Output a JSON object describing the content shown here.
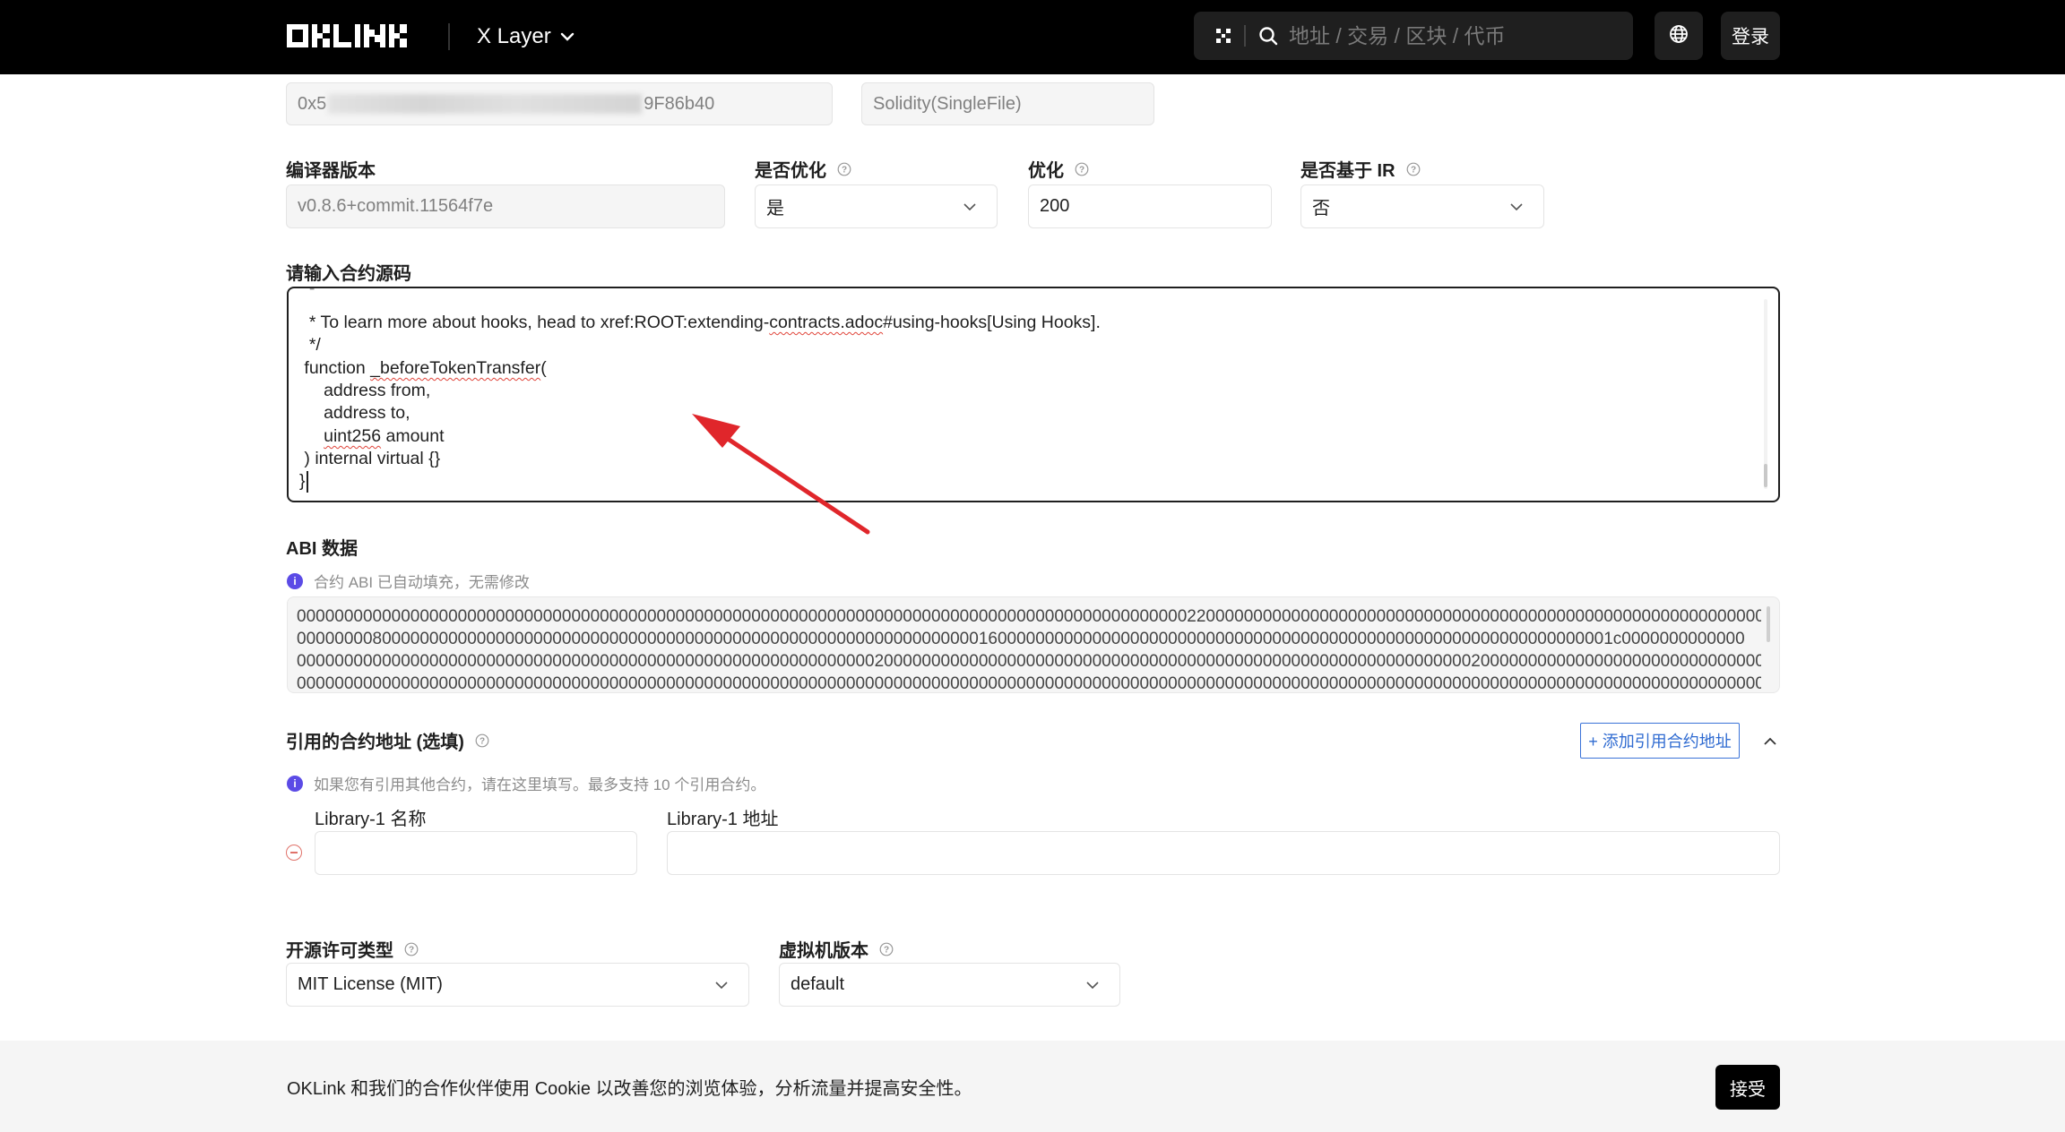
{
  "header": {
    "logo": "OKLINK",
    "network": "X Layer",
    "search_placeholder": "地址 / 交易 / 区块 / 代币",
    "login": "登录"
  },
  "top_fields": {
    "address_prefix": "0x5",
    "address_suffix": "9F86b40",
    "compiler_type": "Solidity(SingleFile)"
  },
  "compiler": {
    "version_label": "编译器版本",
    "version_value": "v0.8.6+commit.11564f7e",
    "optimize_label": "是否优化",
    "optimize_value": "是",
    "runs_label": "优化",
    "runs_value": "200",
    "ir_label": "是否基于 IR",
    "ir_value": "否"
  },
  "source": {
    "label": "请输入合约源码",
    "lines": [
      "  * To learn more about hooks, head to xref:ROOT:extending-contracts.adoc#using-hooks[Using Hooks].",
      "  */",
      " function _beforeTokenTransfer(",
      "     address from,",
      "     address to,",
      "     uint256 amount",
      " ) internal virtual {}",
      "}"
    ]
  },
  "abi": {
    "label": "ABI 数据",
    "note": "合约 ABI 已自动填充，无需修改",
    "lines": [
      "0000000000000000000000000000000000000000000000000000000000000000000000000000000000000000000000220000000000000000000000000000000000000000000000000000000000000000",
      "0000000080000000000000000000000000000000000000000000000000000000000000001600000000000000000000000000000000000000000000000000000000000000001c0000000000000",
      "0000000000000000000000000000000000000000000000000000000000000200000000000000000000000000000000000000000000000000000000000000200000000000000000000000000000000000",
      "0000000000000000000000000000000000000000000000000000000000000000000000000000000000000000000000000000000000000000000000000000000000000000000000000000000000000000"
    ]
  },
  "libraries": {
    "label": "引用的合约地址 (选填)",
    "add_button": "+ 添加引用合约地址",
    "note": "如果您有引用其他合约，请在这里填写。最多支持 10 个引用合约。",
    "name_label": "Library-1 名称",
    "address_label": "Library-1 地址"
  },
  "license": {
    "label": "开源许可类型",
    "value": "MIT License (MIT)"
  },
  "evm": {
    "label": "虚拟机版本",
    "value": "default"
  },
  "cookie": {
    "text": "OKLink 和我们的合作伙伴使用 Cookie 以改善您的浏览体验，分析流量并提高安全性。",
    "accept": "接受"
  },
  "colors": {
    "header_bg": "#000000",
    "accent_blue": "#2f6bd1",
    "info_purple": "#5b4be6",
    "annotation_arrow": "#e0262b"
  }
}
